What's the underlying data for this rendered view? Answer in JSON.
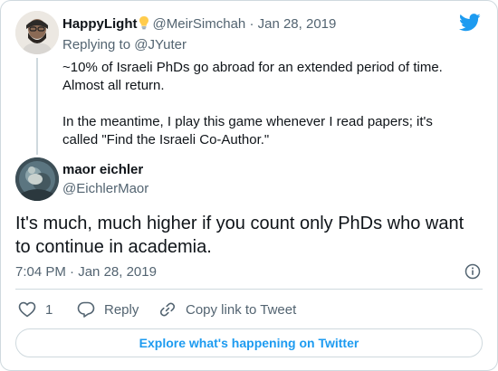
{
  "parent_tweet": {
    "author_name": "HappyLight",
    "author_handle": "@MeirSimchah",
    "separator": "·",
    "date": "Jan 28, 2019",
    "replying_prefix": "Replying to",
    "replying_handle": "@JYuter",
    "paragraphs": [
      "~10% of Israeli PhDs go abroad for an extended period of time. Almost all return.",
      "In the meantime, I play this game whenever I read papers; it's called \"Find the Israeli Co-Author.\""
    ]
  },
  "main_tweet": {
    "author_name": "maor eichler",
    "author_handle": "@EichlerMaor",
    "text": "It's much, much higher if you count only PhDs who want to continue in academia.",
    "time": "7:04 PM",
    "separator": "·",
    "date": "Jan 28, 2019"
  },
  "actions": {
    "like_count": "1",
    "reply_label": "Reply",
    "copy_label": "Copy link to Tweet"
  },
  "explore_label": "Explore what's happening on Twitter",
  "icons": {
    "brand": "twitter-bird-icon",
    "info": "info-icon",
    "like": "heart-icon",
    "reply": "reply-bubble-icon",
    "copy": "link-icon",
    "badge": "lightbulb-icon"
  },
  "colors": {
    "brand_blue": "#1d9bf0",
    "text": "#0f1419",
    "muted": "#536471",
    "border": "#cfd9de"
  }
}
